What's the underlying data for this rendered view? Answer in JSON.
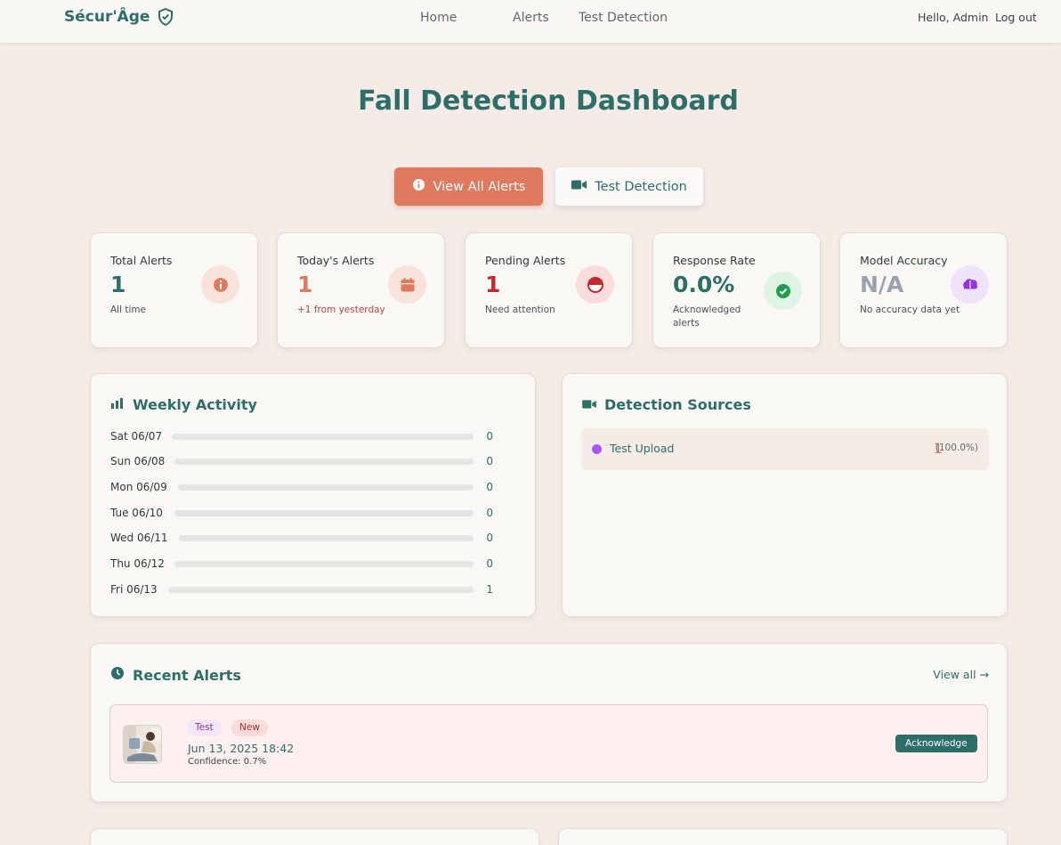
{
  "nav": {
    "brand": "Sécur'Âge",
    "links": [
      "Home",
      "Alerts",
      "Test Detection"
    ],
    "greeting": "Hello, Admin",
    "logout": "Log out"
  },
  "page": {
    "title": "Fall Detection Dashboard"
  },
  "actions": {
    "view_all_alerts": "View All Alerts",
    "test_detection": "Test Detection"
  },
  "stats": [
    {
      "label": "Total Alerts",
      "value": "1",
      "sub": "All time",
      "value_color": "#2d6e69",
      "sub_color": "#4a5555",
      "icon": "info-icon",
      "icon_bg": "#f7e3dc",
      "icon_color": "#e07a5f"
    },
    {
      "label": "Today's Alerts",
      "value": "1",
      "sub": "+1 from yesterday",
      "value_color": "#e07a5f",
      "sub_color": "#c0453b",
      "icon": "calendar-icon",
      "icon_bg": "#f7e3dc",
      "icon_color": "#e07a5f"
    },
    {
      "label": "Pending Alerts",
      "value": "1",
      "sub": "Need attention",
      "value_color": "#c4292b",
      "sub_color": "#4a5555",
      "icon": "half-circle-icon",
      "icon_bg": "#fbdcdc",
      "icon_color": "#c4292b"
    },
    {
      "label": "Response Rate",
      "value": "0.0%",
      "sub": "Acknowledged alerts",
      "value_color": "#2d6e69",
      "sub_color": "#4a5555",
      "icon": "check-circle-icon",
      "icon_bg": "#dff5e4",
      "icon_color": "#1f9d4b"
    },
    {
      "label": "Model Accuracy",
      "value": "N/A",
      "sub": "No accuracy data yet",
      "value_color": "#9aa3ad",
      "sub_color": "#4a5555",
      "icon": "brain-icon",
      "icon_bg": "#efe2fb",
      "icon_color": "#9333ea"
    }
  ],
  "weekly": {
    "title": "Weekly Activity",
    "days": [
      {
        "day": "Sat 06/07",
        "count": 0
      },
      {
        "day": "Sun 06/08",
        "count": 0
      },
      {
        "day": "Mon 06/09",
        "count": 0
      },
      {
        "day": "Tue 06/10",
        "count": 0
      },
      {
        "day": "Wed 06/11",
        "count": 0
      },
      {
        "day": "Thu 06/12",
        "count": 0
      },
      {
        "day": "Fri 06/13",
        "count": 1
      }
    ]
  },
  "sources": {
    "title": "Detection Sources",
    "items": [
      {
        "name": "Test Upload",
        "count": "1",
        "pct": "(100.0%)"
      }
    ]
  },
  "recent": {
    "title": "Recent Alerts",
    "view_all": "View all →",
    "items": [
      {
        "tag_type": "Test",
        "tag_status": "New",
        "date": "Jun 13, 2025 18:42",
        "confidence": "Confidence: 0.7%",
        "action": "Acknowledge"
      }
    ]
  },
  "colors": {
    "brand": "#2d6e69",
    "accent": "#e07a5f",
    "background": "#f5ece8"
  }
}
